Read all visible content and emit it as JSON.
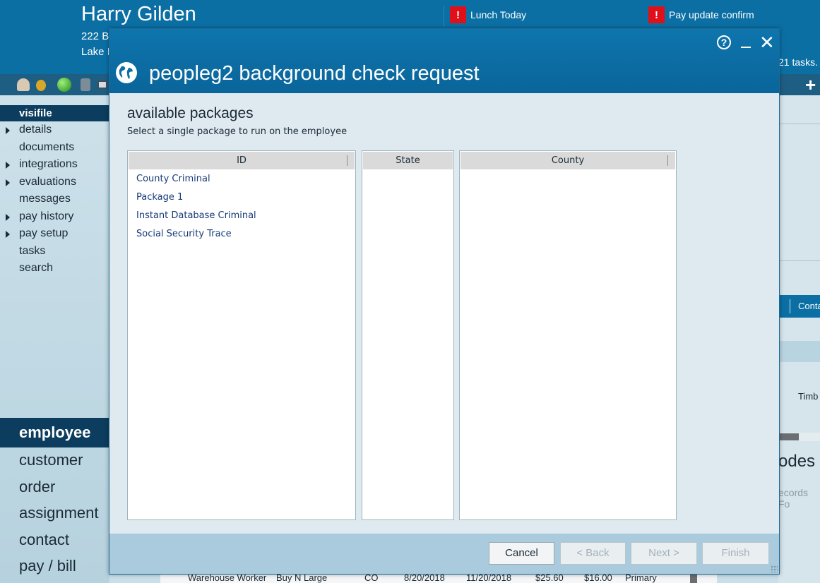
{
  "header": {
    "employee_name": "Harry Gilden",
    "address_line1": "222 B",
    "address_line2": "Lake I",
    "alerts": [
      {
        "label": "Lunch Today",
        "icon": "exclamation-icon",
        "color": "#e0101b"
      },
      {
        "label": "Pay update confirm",
        "icon": "exclamation-icon",
        "color": "#e0101b"
      }
    ],
    "tasks_count": "21 tasks."
  },
  "toolbar": {
    "icons": [
      "person-icon",
      "coin-icon",
      "status-green-icon",
      "document-icon",
      "id-card-icon"
    ],
    "add_icon": "+"
  },
  "sidebar": {
    "active_section": "visifile",
    "items": [
      {
        "label": "details",
        "expandable": true
      },
      {
        "label": "documents",
        "expandable": false
      },
      {
        "label": "integrations",
        "expandable": true
      },
      {
        "label": "evaluations",
        "expandable": true
      },
      {
        "label": "messages",
        "expandable": false
      },
      {
        "label": "pay history",
        "expandable": true
      },
      {
        "label": "pay setup",
        "expandable": true
      },
      {
        "label": "tasks",
        "expandable": false
      },
      {
        "label": "search",
        "expandable": false
      }
    ],
    "nav": [
      "employee",
      "customer",
      "order",
      "assignment",
      "contact",
      "pay / bill"
    ],
    "nav_active": "employee"
  },
  "right_panel": {
    "tab_label": "Conta",
    "field_text": "Timb",
    "section_title": "odes",
    "section_sub": "ecords Fo"
  },
  "bottom_row": [
    "Warehouse Worker",
    "Buy N Large",
    "CO",
    "8/20/2018",
    "11/20/2018",
    "$25.60",
    "$16.00",
    "Primary"
  ],
  "dialog": {
    "title": "peopleg2 background check request",
    "help_label": "?",
    "heading": "available packages",
    "subheading": "Select a single package to run on the employee",
    "columns": {
      "id": "ID",
      "state": "State",
      "county": "County"
    },
    "packages": [
      "County Criminal",
      "Package 1",
      "Instant Database Criminal",
      "Social Security Trace"
    ],
    "buttons": {
      "cancel": "Cancel",
      "back": "< Back",
      "next": "Next >",
      "finish": "Finish"
    },
    "colors": {
      "header": "#0b6fa4",
      "body": "#dfeaf0",
      "footer": "#a9cbdd",
      "package_text": "#163a78"
    }
  }
}
